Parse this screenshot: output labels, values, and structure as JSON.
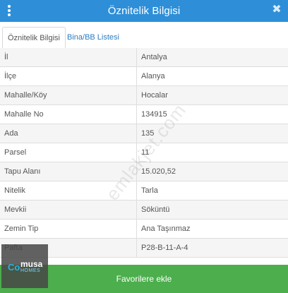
{
  "header": {
    "title": "Öznitelik Bilgisi",
    "menu_icon": "more-vertical-icon",
    "close_icon": "close-icon",
    "close_glyph": "✖",
    "background": "#2e8fd8"
  },
  "tabs": [
    {
      "label": "Öznitelik Bilgisi",
      "active": true
    },
    {
      "label": "Bina/BB Listesi",
      "active": false
    }
  ],
  "attributes": [
    {
      "label": "İl",
      "value": "Antalya"
    },
    {
      "label": "İlçe",
      "value": "Alanya"
    },
    {
      "label": "Mahalle/Köy",
      "value": "Hocalar"
    },
    {
      "label": "Mahalle No",
      "value": "134915"
    },
    {
      "label": "Ada",
      "value": "135"
    },
    {
      "label": "Parsel",
      "value": "11"
    },
    {
      "label": "Tapu Alanı",
      "value": "15.020,52"
    },
    {
      "label": "Nitelik",
      "value": "Tarla"
    },
    {
      "label": "Mevkii",
      "value": "Söküntü"
    },
    {
      "label": "Zemin Tip",
      "value": "Ana Taşınmaz"
    },
    {
      "label": "Pafta",
      "value": "P28-B-11-A-4"
    }
  ],
  "footer": {
    "button_label": "Favorilere ekle",
    "color": "#4cae4c"
  },
  "watermark": "emlakjet.com",
  "logo": {
    "mark": "Co",
    "name": "musa",
    "sub": "HOMES"
  }
}
